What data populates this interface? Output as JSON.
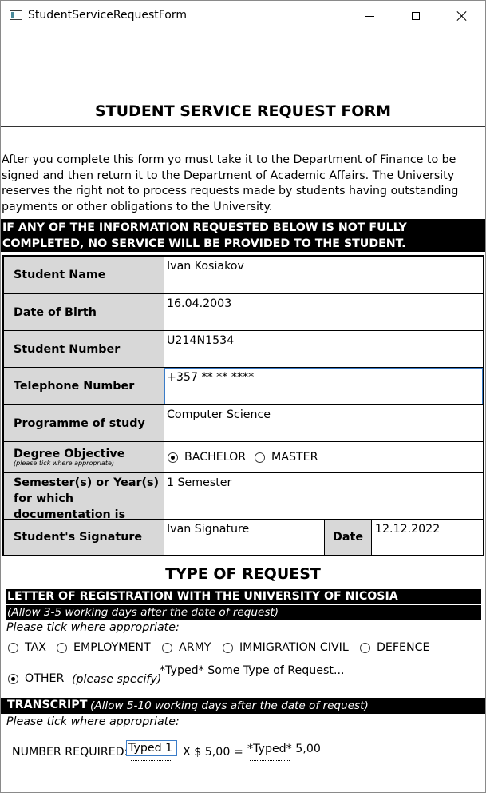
{
  "window": {
    "title": "StudentServiceRequestForm"
  },
  "form": {
    "title": "STUDENT SERVICE REQUEST FORM",
    "intro": "After you complete this form yo must take it to the Department of Finance to be signed and then return it to the Department of Academic Affairs. The University reserves the right not to process requests made by students having outstanding payments or other obligations to the University.",
    "warning": "IF ANY OF THE INFORMATION REQUESTED BELOW IS NOT FULLY COMPLETED, NO SERVICE WILL BE PROVIDED TO THE STUDENT."
  },
  "fields": {
    "student_name": {
      "label": "Student Name",
      "value": "Ivan Kosiakov"
    },
    "date_of_birth": {
      "label": "Date of Birth",
      "value": "16.04.2003"
    },
    "student_number": {
      "label": "Student Number",
      "value": "U214N1534"
    },
    "telephone": {
      "label": "Telephone Number",
      "value": "+357 ** ** ****"
    },
    "programme": {
      "label": "Programme of study",
      "value": "Computer Science"
    },
    "degree": {
      "label": "Degree Objective",
      "hint": "(please tick where appropriate)",
      "options": [
        "BACHELOR",
        "MASTER"
      ],
      "selected": "BACHELOR"
    },
    "semester": {
      "label": "Semester(s) or Year(s) for which documentation is requested",
      "value": "1 Semester"
    },
    "signature": {
      "label": "Student's Signature",
      "value": "Ivan Signature"
    },
    "date": {
      "label": "Date",
      "value": "12.12.2022"
    }
  },
  "request": {
    "title": "TYPE OF REQUEST",
    "letter": {
      "heading": "LETTER OF REGISTRATION WITH THE UNIVERSITY OF NICOSIA",
      "note": "(Allow 3-5 working days after the date of request)",
      "tick_hint": "Please tick where appropriate:",
      "options": [
        "TAX",
        "EMPLOYMENT",
        "ARMY",
        "IMMIGRATION CIVIL",
        "DEFENCE"
      ],
      "other_label": "OTHER",
      "other_specify": "(please specify)",
      "other_value": "*Typed* Some Type of Request...",
      "selected": "OTHER"
    },
    "transcript": {
      "heading": "TRANSCRIPT",
      "note": "(Allow 5-10 working days after the date of request)",
      "tick_hint": "Please tick where appropriate:",
      "number_label": "NUMBER REQUIRED:",
      "number_value": "Typed 1",
      "multiplier": "X $ 5,00 =",
      "total": "*Typed* 5,00"
    }
  }
}
